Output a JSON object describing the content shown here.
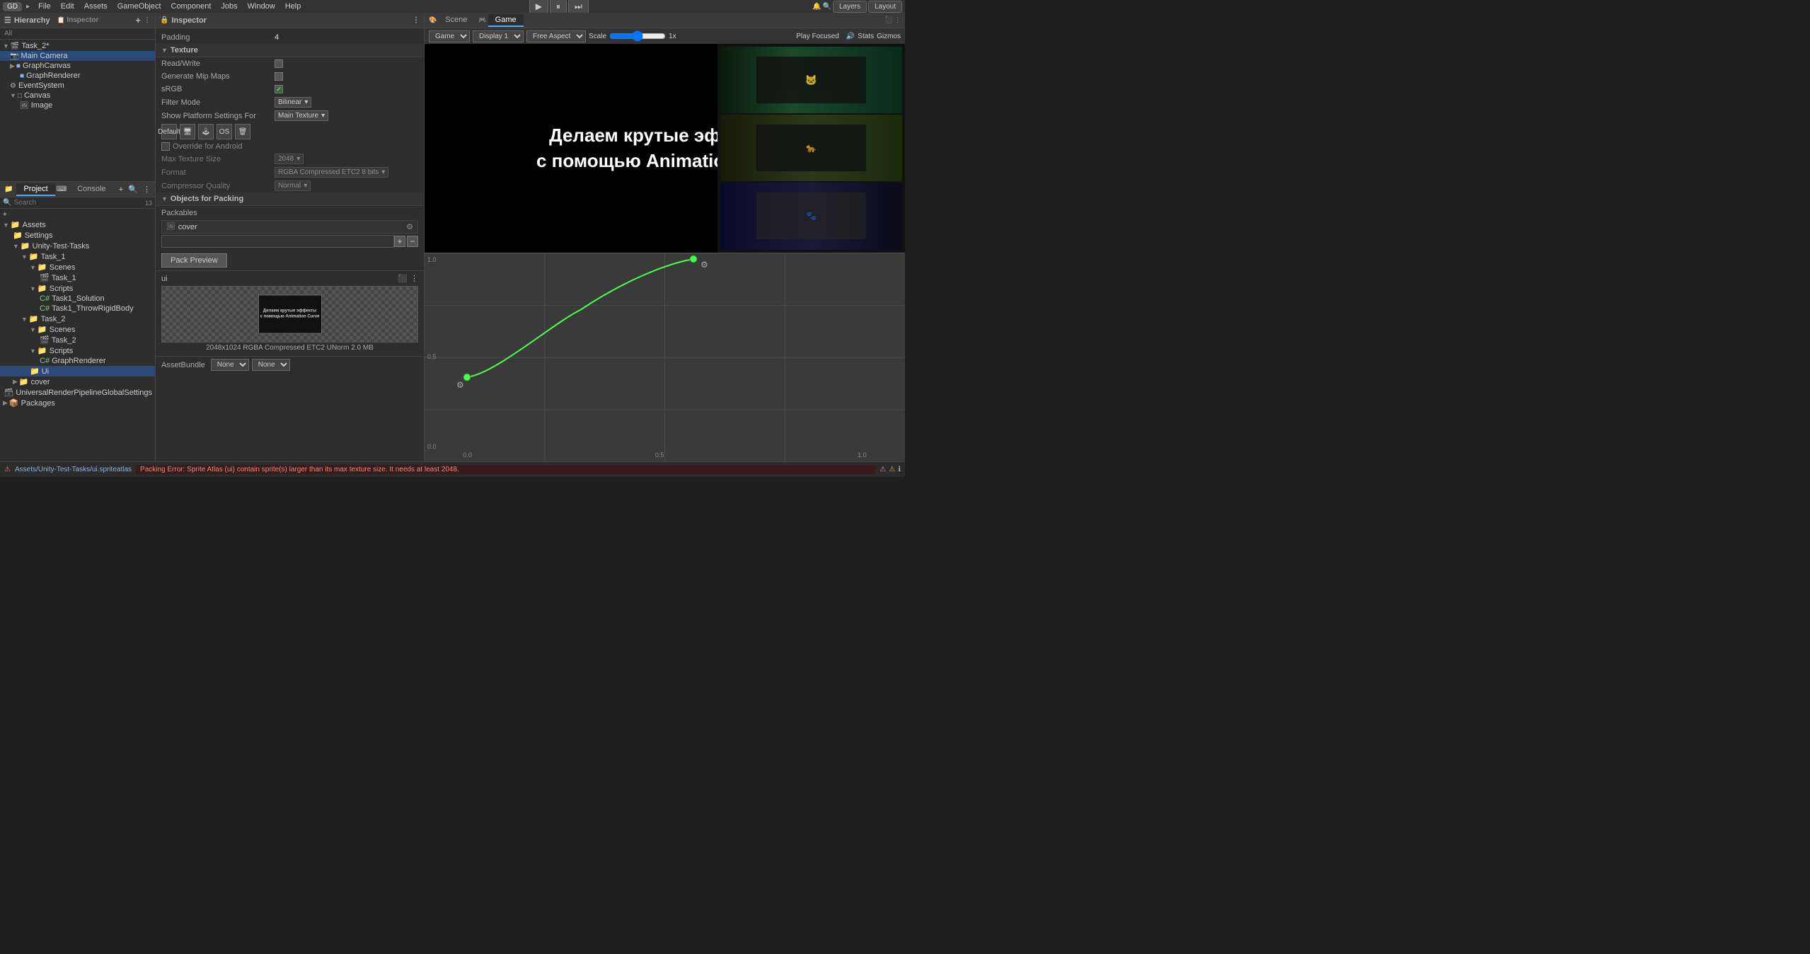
{
  "menubar": {
    "items": [
      "File",
      "Edit",
      "Assets",
      "GameObject",
      "Component",
      "Jobs",
      "Window",
      "Help"
    ],
    "gd_label": "GD"
  },
  "toolbar": {
    "play_btn": "▶",
    "pause_btn": "⏸",
    "step_btn": "⏭",
    "layers_label": "Layers",
    "layout_label": "Layout",
    "search_icon": "🔍",
    "settings_icon": "⚙"
  },
  "hierarchy": {
    "title": "Hierarchy",
    "add_btn": "+",
    "all_label": "All",
    "items": [
      {
        "label": "Task_2*",
        "indent": 0,
        "icon": "▸",
        "type": "scene"
      },
      {
        "label": "Main Camera",
        "indent": 1,
        "icon": "📷",
        "type": "camera"
      },
      {
        "label": "GraphCanvas",
        "indent": 2,
        "icon": "▸",
        "type": "obj"
      },
      {
        "label": "GraphRenderer",
        "indent": 3,
        "icon": " ",
        "type": "obj"
      },
      {
        "label": "EventSystem",
        "indent": 2,
        "icon": "⚙",
        "type": "obj"
      },
      {
        "label": "Canvas",
        "indent": 2,
        "icon": "▸",
        "type": "obj"
      },
      {
        "label": "Image",
        "indent": 3,
        "icon": " ",
        "type": "obj"
      }
    ]
  },
  "inspector": {
    "title": "Inspector",
    "padding_label": "Padding",
    "padding_value": "4",
    "texture_section": "Texture",
    "read_write_label": "Read/Write",
    "generate_mip_maps_label": "Generate Mip Maps",
    "srgb_label": "sRGB",
    "filter_mode_label": "Filter Mode",
    "filter_mode_value": "Bilinear",
    "show_platform_label": "Show Platform Settings For",
    "show_platform_value": "Main Texture",
    "default_label": "Default",
    "override_android_label": "Override for Android",
    "max_texture_label": "Max Texture Size",
    "max_texture_value": "2048",
    "format_label": "Format",
    "format_value": "RGBA Compressed ETC2 8 bits",
    "compressor_label": "Compressor Quality",
    "compressor_value": "Normal",
    "objects_packing_label": "Objects for Packing",
    "packables_label": "Packables",
    "packable_item": "cover",
    "pack_preview_btn": "Pack Preview",
    "preview_label": "ui",
    "preview_caption": "2048x1024 RGBA Compressed ETC2 UNorm  2.0 MB",
    "assetbundle_label": "AssetBundle",
    "assetbundle_value1": "None",
    "assetbundle_value2": "None"
  },
  "scene_tabs": {
    "scene_label": "Scene",
    "game_label": "Game"
  },
  "game_toolbar": {
    "game_label": "Game",
    "display_label": "Display 1",
    "aspect_label": "Free Aspect",
    "scale_label": "Scale",
    "scale_value": "1x",
    "play_focused_label": "Play Focused",
    "stats_label": "Stats",
    "gizmos_label": "Gizmos"
  },
  "game_view": {
    "title_line1": "Делаем крутые эффекты",
    "title_line2": "с помощью Animation Curve"
  },
  "project": {
    "title": "Project",
    "console_label": "Console",
    "search_placeholder": "Search",
    "count": "13",
    "assets_label": "Assets",
    "items": [
      {
        "label": "Settings",
        "indent": 1,
        "type": "folder"
      },
      {
        "label": "Unity-Test-Tasks",
        "indent": 1,
        "type": "folder"
      },
      {
        "label": "Task_1",
        "indent": 2,
        "type": "folder"
      },
      {
        "label": "Scenes",
        "indent": 3,
        "type": "folder"
      },
      {
        "label": "Task_1",
        "indent": 4,
        "type": "scene"
      },
      {
        "label": "Scripts",
        "indent": 3,
        "type": "folder"
      },
      {
        "label": "Task1_Solution",
        "indent": 4,
        "type": "cs"
      },
      {
        "label": "Task1_ThrowRigidBody",
        "indent": 4,
        "type": "cs"
      },
      {
        "label": "Task_2",
        "indent": 2,
        "type": "folder"
      },
      {
        "label": "Scenes",
        "indent": 3,
        "type": "folder"
      },
      {
        "label": "Task_2",
        "indent": 4,
        "type": "scene"
      },
      {
        "label": "Scripts",
        "indent": 3,
        "type": "folder"
      },
      {
        "label": "GraphRenderer",
        "indent": 4,
        "type": "cs"
      },
      {
        "label": "Ui",
        "indent": 3,
        "type": "folder",
        "selected": true
      },
      {
        "label": "cover",
        "indent": 2,
        "type": "folder"
      },
      {
        "label": "UniversalRenderPipelineGlobalSettings",
        "indent": 1,
        "type": "asset"
      },
      {
        "label": "Packages",
        "indent": 0,
        "type": "folder"
      }
    ]
  },
  "curve_editor": {
    "labels_y": [
      "1.0",
      "0.5",
      "0.0"
    ],
    "labels_x": [
      "0.0",
      "0.5",
      "1.0"
    ]
  },
  "status_bar": {
    "path_label": "Assets/Unity-Test-Tasks/ui.spriteatlas",
    "error_text": "Packing Error: Sprite Atlas (ui) contain sprite(s) larger than its max texture size. It needs at least 2048."
  }
}
